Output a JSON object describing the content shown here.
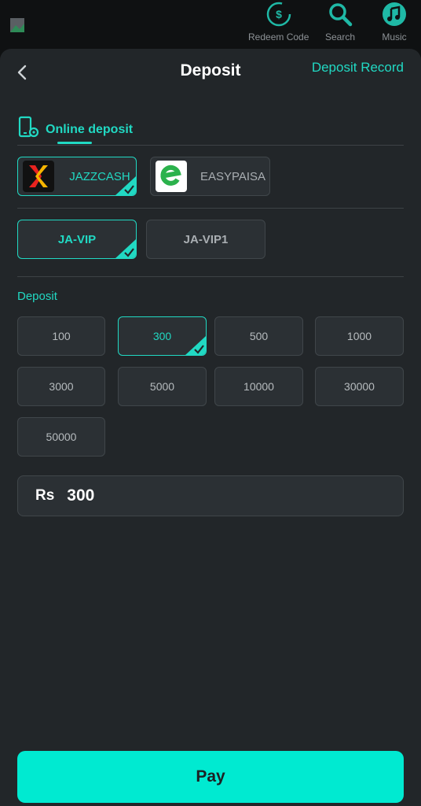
{
  "top_actions": [
    {
      "label": "Redeem Code",
      "icon": "redeem-icon"
    },
    {
      "label": "Search",
      "icon": "search-icon"
    },
    {
      "label": "Music",
      "icon": "music-icon"
    }
  ],
  "header": {
    "title": "Deposit",
    "record_link": "Deposit Record"
  },
  "tab": {
    "label": "Online deposit",
    "icon": "phone-settings-icon"
  },
  "methods": [
    {
      "label": "JAZZCASH",
      "selected": true
    },
    {
      "label": "EASYPAISA",
      "selected": false
    }
  ],
  "channels": [
    {
      "label": "JA-VIP",
      "selected": true
    },
    {
      "label": "JA-VIP1",
      "selected": false
    }
  ],
  "deposit_section_label": "Deposit",
  "amounts": [
    {
      "label": "100",
      "selected": false
    },
    {
      "label": "300",
      "selected": true
    },
    {
      "label": "500",
      "selected": false
    },
    {
      "label": "1000",
      "selected": false
    },
    {
      "label": "3000",
      "selected": false
    },
    {
      "label": "5000",
      "selected": false
    },
    {
      "label": "10000",
      "selected": false
    },
    {
      "label": "30000",
      "selected": false
    },
    {
      "label": "50000",
      "selected": false
    }
  ],
  "amount_input": {
    "currency": "Rs",
    "value": "300"
  },
  "pay_button": "Pay",
  "colors": {
    "accent": "#21d9c3",
    "pay": "#00ead1",
    "panel": "#222629",
    "card": "#2b3034"
  }
}
